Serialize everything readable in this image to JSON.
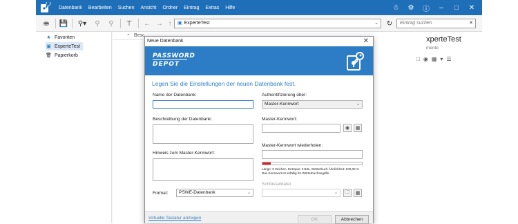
{
  "menu": [
    "Datenbank",
    "Bearbeiten",
    "Suchen",
    "Ansicht",
    "Ordner",
    "Eintrag",
    "Extras",
    "Hilfe"
  ],
  "title_icons": [
    "user-lock-icon",
    "gear-icon",
    "help-icon",
    "minimize-icon",
    "maximize-icon",
    "close-icon"
  ],
  "toolbar": {
    "path": "ExperteTest",
    "search_placeholder": "Eintrag suchen"
  },
  "sidebar": {
    "items": [
      {
        "label": "Favoriten",
        "icon": "star-folder-icon"
      },
      {
        "label": "ExperteTest",
        "icon": "database-icon"
      },
      {
        "label": "Papierkorb",
        "icon": "trash-icon"
      }
    ]
  },
  "main": {
    "column_partial": "Besc",
    "right_title": "xperteTest",
    "right_subtitle": "mente"
  },
  "dialog": {
    "title": "Neue Datenbank",
    "logo_line1": "PASSWORD",
    "logo_line2": "DEPOT",
    "heading": "Legen Sie die Einstellungen der neuen Datenbank fest.",
    "name_label": "Name der Datenbank:",
    "description_label": "Beschreibung der Datenbank:",
    "hint_label": "Hinweis zum Master-Kennwort:",
    "format_label": "Format:",
    "format_value": "PSWE-Datenbank",
    "auth_label": "Authentifizierung über:",
    "auth_value": "Master-Kennwort",
    "master_label": "Master-Kennwort:",
    "repeat_label": "Master-Kennwort wiederholen:",
    "strength_fraction": 0.08,
    "strength_line1": "Länge: 0 Zeichen, Entropie: 0 Bits, Wörterbuch Ähnlichkeit: 100,00 %",
    "strength_line2": "Das Kennwort ist anfällig für Wörterbuchangriffe.",
    "keyfile_label": "Schlüsseldatei:",
    "virtual_keyboard": "Virtuelle Tastatur anzeigen",
    "ok": "OK",
    "cancel": "Abbrechen"
  },
  "colors": {
    "titlebar": "#1f6fb8",
    "banner": "#2c7dc6",
    "accent": "#2c7dc6",
    "strength_fill": "#e02020"
  }
}
